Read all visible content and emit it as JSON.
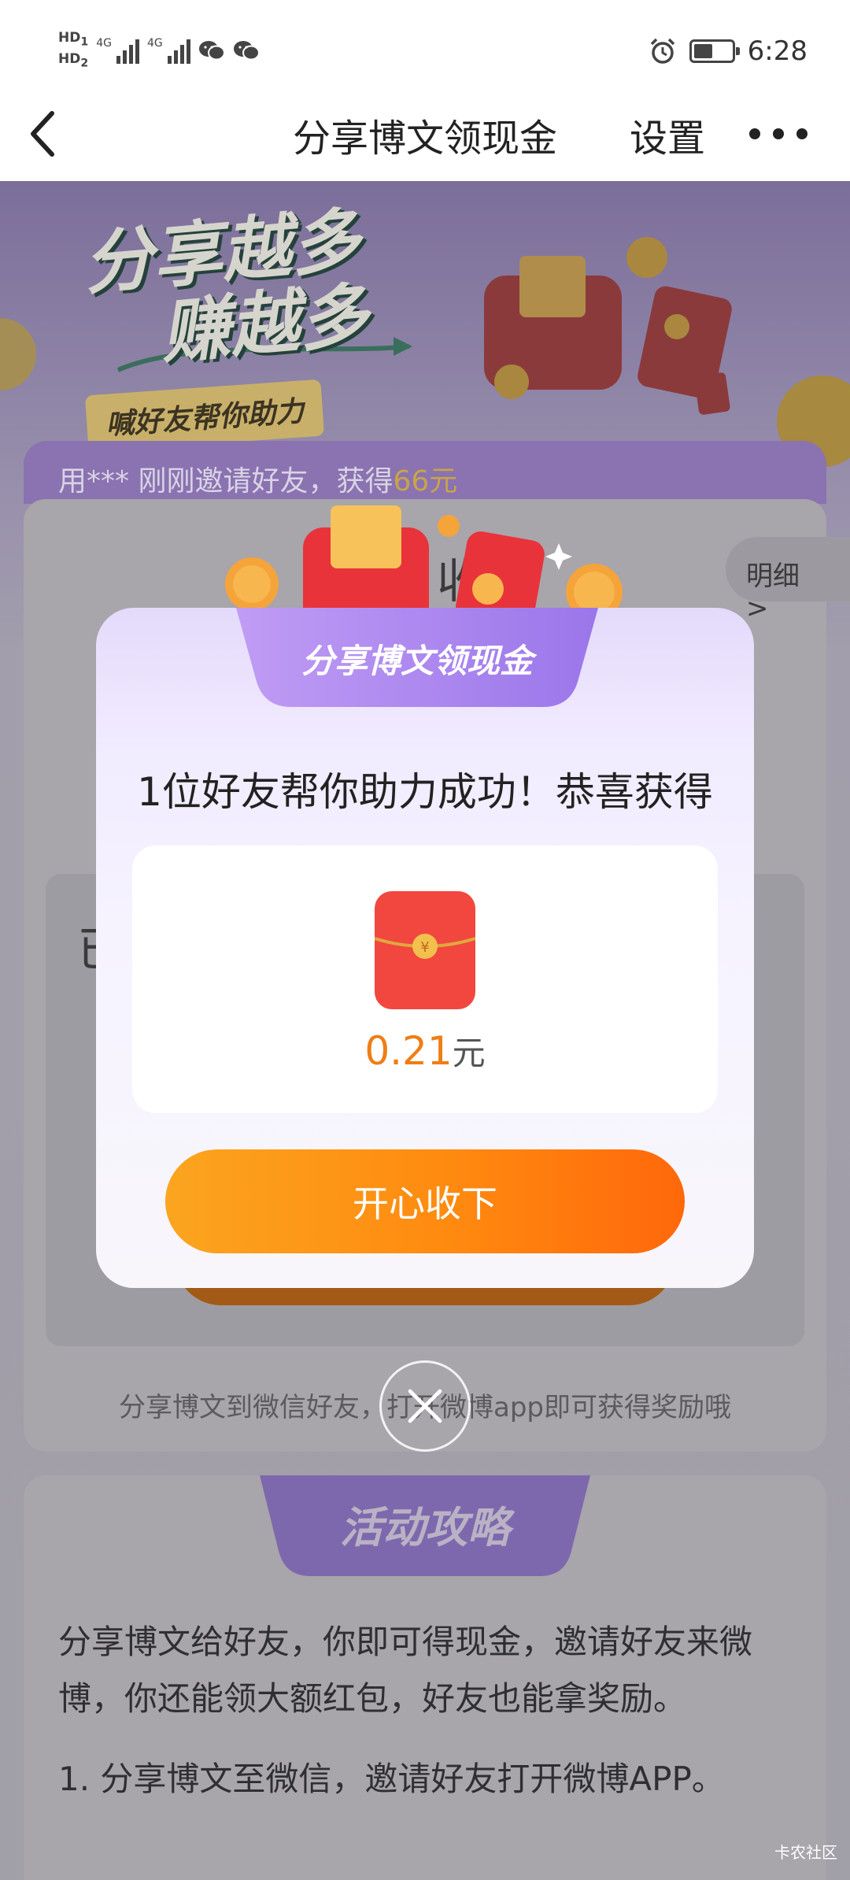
{
  "status_bar": {
    "left": {
      "hd1": "HD",
      "hd1_sub": "1",
      "hd2": "HD",
      "hd2_sub": "2",
      "net1": "4G",
      "net2": "4G",
      "icons": [
        "wechat-icon",
        "wechat-icon"
      ]
    },
    "right": {
      "time": "6:28",
      "icons": [
        "alarm-icon",
        "battery-icon"
      ],
      "battery_level": 0.5
    }
  },
  "nav": {
    "back_icon": "chevron-left-icon",
    "title": "分享博文领现金",
    "settings_label": "设置",
    "more_icon": "more-horizontal-icon"
  },
  "hero": {
    "title_line1": "分享越多",
    "title_line2": "赚越多",
    "subtitle": "喊好友帮你助力"
  },
  "ticker": {
    "text": "用*** 刚刚邀请好友，获得",
    "amount": "66元"
  },
  "card": {
    "detail_label": "明细 >",
    "partial_heading": "收",
    "partial_char": "已",
    "share_tip": "分享博文到微信好友，打开微博app即可获得奖励哦"
  },
  "strategy": {
    "label": "活动攻略",
    "para1": "分享博文给好友，你即可得现金，邀请好友来微博，你还能领大额红包，好友也能拿奖励。",
    "para2": "1. 分享博文至微信，邀请好友打开微博APP。"
  },
  "modal": {
    "tab_label": "分享博文领现金",
    "message": "1位好友帮你助力成功！恭喜获得",
    "amount": "0.21",
    "unit": "元",
    "button_label": "开心收下",
    "close_icon": "close-icon"
  },
  "watermark": "卡农社区",
  "colors": {
    "accent_orange": "#ff8a10",
    "purple": "#a58bf0",
    "amount": "#ee7e16"
  }
}
